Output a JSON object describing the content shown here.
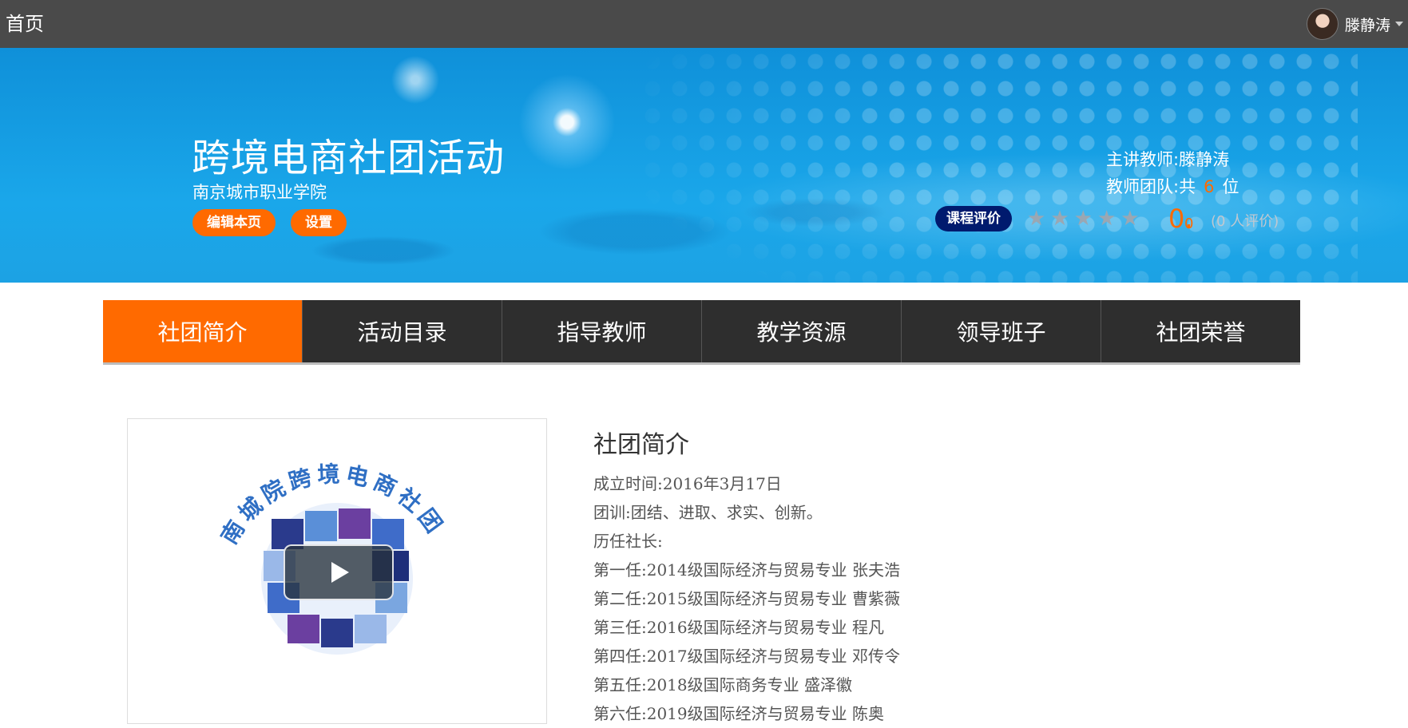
{
  "topbar": {
    "home_label": "首页",
    "username": "滕静涛",
    "avatar_icon": "user-avatar",
    "dropdown_icon": "chevron-down-icon"
  },
  "banner": {
    "title": "跨境电商社团活动",
    "school": "南京城市职业学院",
    "edit_button": "编辑本页",
    "settings_button": "设置",
    "main_teacher_label": "主讲教师:",
    "main_teacher_name": "滕静涛",
    "team_label": "教师团队:共",
    "team_count": "6",
    "team_unit": "位",
    "rating_badge": "课程评价",
    "rating_stars": 0,
    "rating_max": 5,
    "score_int": "0.",
    "score_dec": "0",
    "rating_count": "(0 人评价)"
  },
  "nav": {
    "tabs": [
      {
        "label": "社团简介",
        "active": true
      },
      {
        "label": "活动目录",
        "active": false
      },
      {
        "label": "指导教师",
        "active": false
      },
      {
        "label": "教学资源",
        "active": false
      },
      {
        "label": "领导班子",
        "active": false
      },
      {
        "label": "社团荣誉",
        "active": false
      }
    ]
  },
  "media": {
    "logo_text": "南城院跨境电商社团",
    "play_icon": "play-icon"
  },
  "intro": {
    "heading": "社团简介",
    "lines": [
      "成立时间:2016年3月17日",
      "团训:团结、进取、求实、创新。",
      "历任社长:",
      "第一任:2014级国际经济与贸易专业 张夫浩",
      "第二任:2015级国际经济与贸易专业 曹紫薇",
      "第三任:2016级国际经济与贸易专业 程凡",
      "第四任:2017级国际经济与贸易专业 邓传令",
      "第五任:2018级国际商务专业 盛泽徽",
      "第六任:2019级国际经济与贸易专业 陈奥"
    ]
  },
  "colors": {
    "accent": "#ff6a00",
    "nav_bg": "#2e2e2e",
    "topbar_bg": "#4a4a4a",
    "banner_blue": "#1aa7ea",
    "badge_navy": "#001a6e"
  }
}
